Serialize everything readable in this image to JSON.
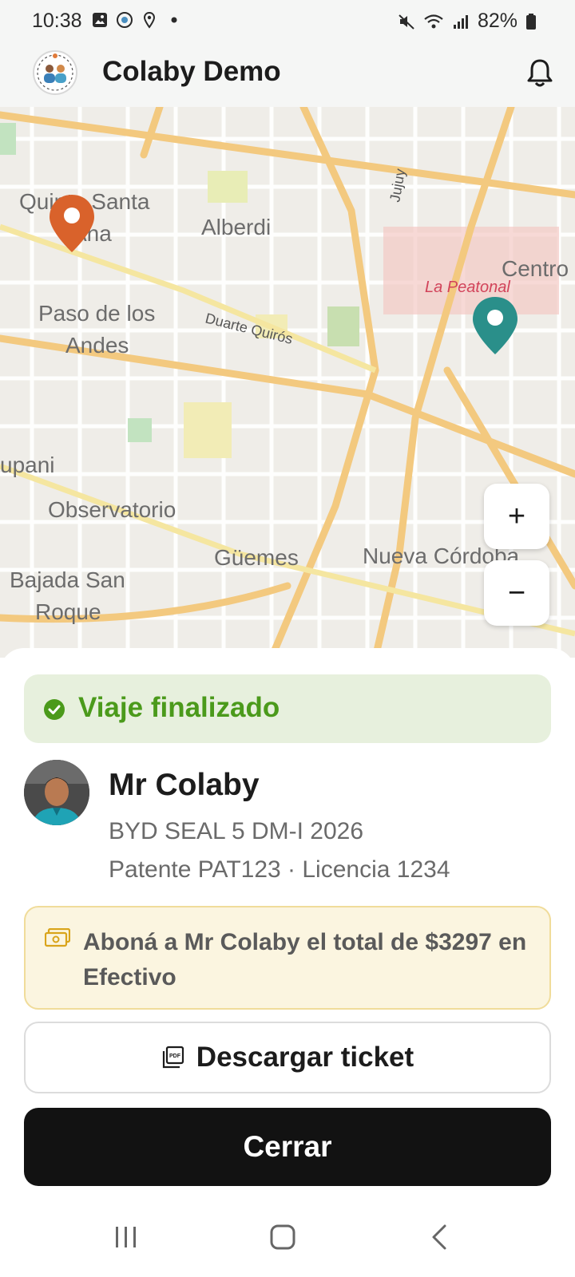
{
  "status_bar": {
    "time": "10:38",
    "battery": "82%",
    "icons_left": [
      "gallery-icon",
      "app-icon",
      "location-icon",
      "dot-icon"
    ],
    "icons_right": [
      "mute-icon",
      "wifi-icon",
      "signal-icon",
      "battery-icon"
    ]
  },
  "app_bar": {
    "title": "Colaby Demo",
    "logo": "colaby-logo",
    "notification_icon": "bell-icon"
  },
  "map": {
    "labels": [
      "Quinta Santa Ana",
      "Alberdi",
      "Paso de los Andes",
      "Duarte Quirós",
      "La Peatonal",
      "Centro",
      "Jujuy",
      "Observatorio",
      "Güemes",
      "Nueva Córdoba",
      "Bajada San Roque",
      "upani"
    ],
    "origin_marker_color": "#d9622b",
    "destination_marker_color": "#2a8f8a",
    "zoom_in_label": "+",
    "zoom_out_label": "−"
  },
  "trip": {
    "status": "Viaje finalizado",
    "status_color": "#4b9a1b"
  },
  "driver": {
    "name": "Mr Colaby",
    "car": "BYD SEAL 5 DM-I 2026",
    "plate_license": "Patente PAT123 · Licencia 1234"
  },
  "payment": {
    "message": "Aboná a Mr Colaby el total de $3297 en Efectivo"
  },
  "actions": {
    "download_label": "Descargar ticket",
    "close_label": "Cerrar"
  },
  "nav": {
    "items": [
      "recents-icon",
      "home-icon",
      "back-icon"
    ]
  }
}
